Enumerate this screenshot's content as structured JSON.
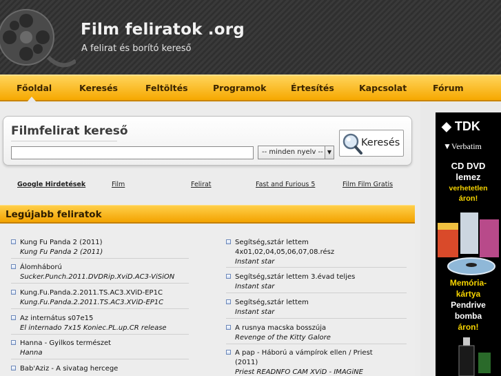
{
  "header": {
    "title": "Film feliratok .org",
    "subtitle": "A felirat és borító kereső"
  },
  "nav": {
    "items": [
      "Főoldal",
      "Keresés",
      "Feltöltés",
      "Programok",
      "Értesítés",
      "Kapcsolat",
      "Fórum"
    ],
    "active": "Főoldal"
  },
  "search": {
    "title": "Filmfelirat kereső",
    "input_value": "",
    "lang_selected": "-- minden nyelv --",
    "button_label": "Keresés"
  },
  "ads": {
    "label": "Google Hirdetések",
    "links": [
      "Film",
      "Felirat",
      "Fast and Furious 5",
      "Film Film Gratis"
    ]
  },
  "latest": {
    "title": "Legújabb feliratok",
    "left": [
      {
        "title": "Kung Fu Panda 2 (2011)",
        "release": "Kung Fu Panda 2 (2011)"
      },
      {
        "title": "Álomháború",
        "release": "Sucker.Punch.2011.DVDRip.XviD.AC3-ViSiON"
      },
      {
        "title": "Kung.Fu.Panda.2.2011.TS.AC3.XViD-EP1C",
        "release": "Kung.Fu.Panda.2.2011.TS.AC3.XViD-EP1C"
      },
      {
        "title": "Az internátus s07e15",
        "release": "El internado 7x15 Koniec.PL.up.CR release"
      },
      {
        "title": "Hanna - Gyilkos természet",
        "release": "Hanna"
      },
      {
        "title": "Bab'Aziz - A sivatag hercege",
        "release": ""
      }
    ],
    "right": [
      {
        "title": "Segítség,sztár lettem",
        "title2": "4x01,02,04,05,06,07,08.rész",
        "release": "Instant star"
      },
      {
        "title": "Segítség,sztár lettem 3.évad teljes",
        "release": "Instant star"
      },
      {
        "title": "Segítség,sztár lettem",
        "release": "Instant star"
      },
      {
        "title": "A rusnya macska bosszúja",
        "release": "Revenge of the Kitty Galore"
      },
      {
        "title": "A pap - Háború a vámpírok ellen / Priest",
        "title2": "(2011)",
        "release": "Priest READNFO CAM XViD - IMAGiNE"
      }
    ]
  },
  "banner": {
    "brand1": "TDK",
    "brand2": "Verbatim",
    "line1": "CD DVD",
    "line2": "lemez",
    "line3": "verhetetlen",
    "line4": "áron!",
    "line5": "Memória-",
    "line6": "kártya",
    "line7": "Pendrive",
    "line8": "bomba",
    "line9": "áron!"
  },
  "colors": {
    "nav_gradient_top": "#ffd45a",
    "nav_gradient_bottom": "#f6a800",
    "header_bg": "#333333",
    "banner_yellow": "#f6d400"
  }
}
